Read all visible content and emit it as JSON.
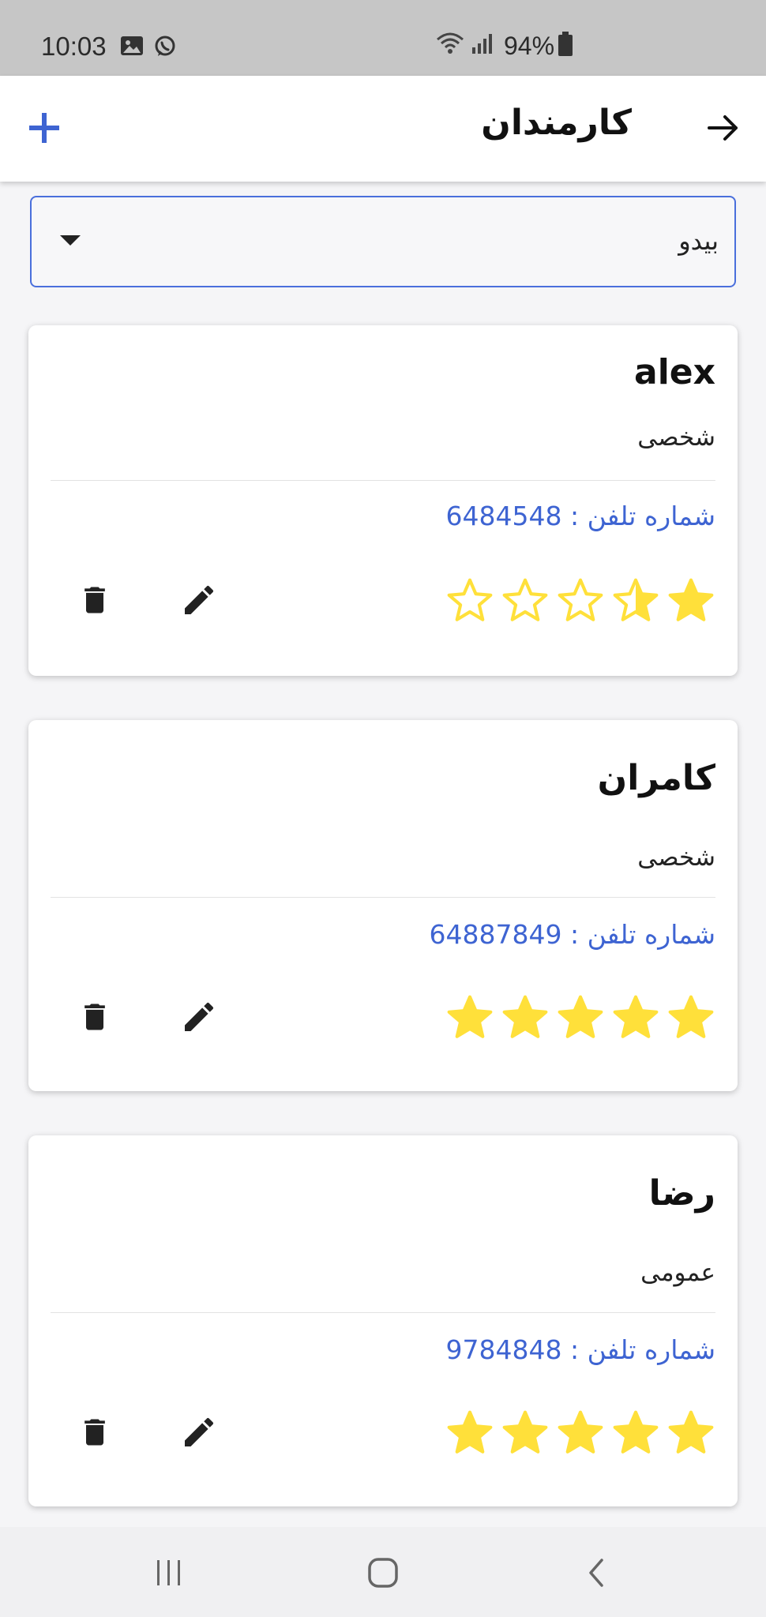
{
  "status_bar": {
    "time": "10:03",
    "battery": "94%",
    "icons": [
      "gallery-icon",
      "whatsapp-icon",
      "wifi-icon",
      "signal-icon",
      "battery-icon"
    ]
  },
  "app_bar": {
    "title": "کارمندان",
    "add_icon": "plus-icon",
    "back_icon": "arrow-right-icon"
  },
  "filter": {
    "selected": "بیدو"
  },
  "employees": [
    {
      "name": "alex",
      "type": "شخصی",
      "phone": "شماره تلفن : 6484548",
      "rating": 1.5
    },
    {
      "name": "کامران",
      "type": "شخصی",
      "phone": "شماره تلفن : 64887849",
      "rating": 5
    },
    {
      "name": "رضا",
      "type": "عمومی",
      "phone": "شماره تلفن : 9784848",
      "rating": 5
    }
  ],
  "colors": {
    "accent": "#3e64d2",
    "star": "#ffe03a",
    "status_bar": "#c6c6c6"
  }
}
